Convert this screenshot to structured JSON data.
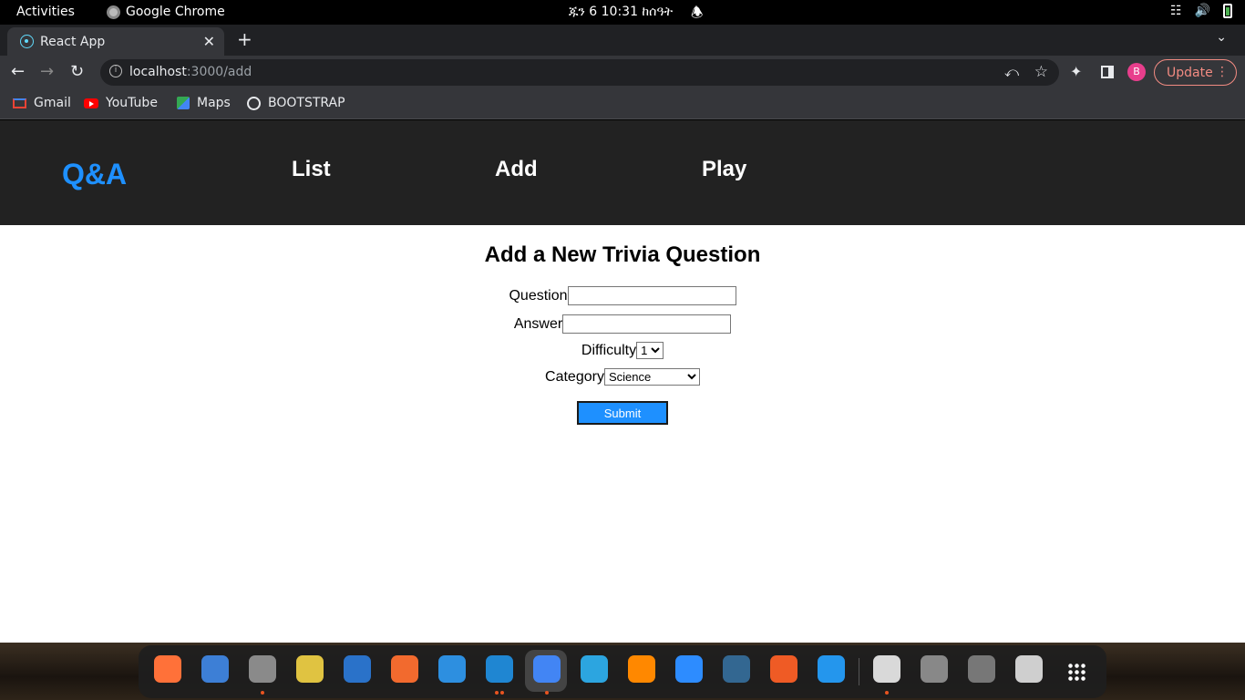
{
  "system": {
    "activities": "Activities",
    "app_name": "Google Chrome",
    "clock": "ጁን 6  10:31 ከሰዓት"
  },
  "browser": {
    "tab_title": "React App",
    "url_host": "localhost",
    "url_path": ":3000/add",
    "profile_initial": "B",
    "update_label": "Update",
    "bookmarks": [
      "Gmail",
      "YouTube",
      "Maps",
      "BOOTSTRAP"
    ]
  },
  "app": {
    "brand": "Q&A",
    "nav": [
      "List",
      "Add",
      "Play"
    ],
    "title": "Add a New Trivia Question",
    "form": {
      "question_label": "Question",
      "question_value": "",
      "answer_label": "Answer",
      "answer_value": "",
      "difficulty_label": "Difficulty",
      "difficulty_selected": "1",
      "category_label": "Category",
      "category_selected": "Science",
      "submit_label": "Submit"
    },
    "colors": {
      "brand": "#1e90ff",
      "nav_bg": "#222222",
      "submit_bg": "#1e90ff"
    }
  },
  "dock": {
    "apps": [
      {
        "name": "firefox-icon",
        "color": "#ff7139"
      },
      {
        "name": "thunderbird-icon",
        "color": "#3d7fd6"
      },
      {
        "name": "files-icon",
        "color": "#8a8a8a"
      },
      {
        "name": "rhythmbox-icon",
        "color": "#e0c341"
      },
      {
        "name": "libreoffice-writer-icon",
        "color": "#2a72c9"
      },
      {
        "name": "software-center-icon",
        "color": "#f26a2e"
      },
      {
        "name": "help-icon",
        "color": "#2d8fe0"
      },
      {
        "name": "vscode-icon",
        "color": "#1f86d2"
      },
      {
        "name": "chrome-icon",
        "color": "#4285f4"
      },
      {
        "name": "telegram-icon",
        "color": "#2ca5e0"
      },
      {
        "name": "vlc-icon",
        "color": "#ff8800"
      },
      {
        "name": "zoom-icon",
        "color": "#2d8cff"
      },
      {
        "name": "postgresql-icon",
        "color": "#336791"
      },
      {
        "name": "postman-icon",
        "color": "#ef5b25"
      },
      {
        "name": "docker-icon",
        "color": "#2496ed"
      }
    ],
    "extras": [
      {
        "name": "document-viewer-icon",
        "color": "#d9d9d9"
      },
      {
        "name": "disk-icon",
        "color": "#888888"
      },
      {
        "name": "usb-drive-icon",
        "color": "#777777"
      },
      {
        "name": "trash-icon",
        "color": "#cfcfcf"
      }
    ]
  }
}
